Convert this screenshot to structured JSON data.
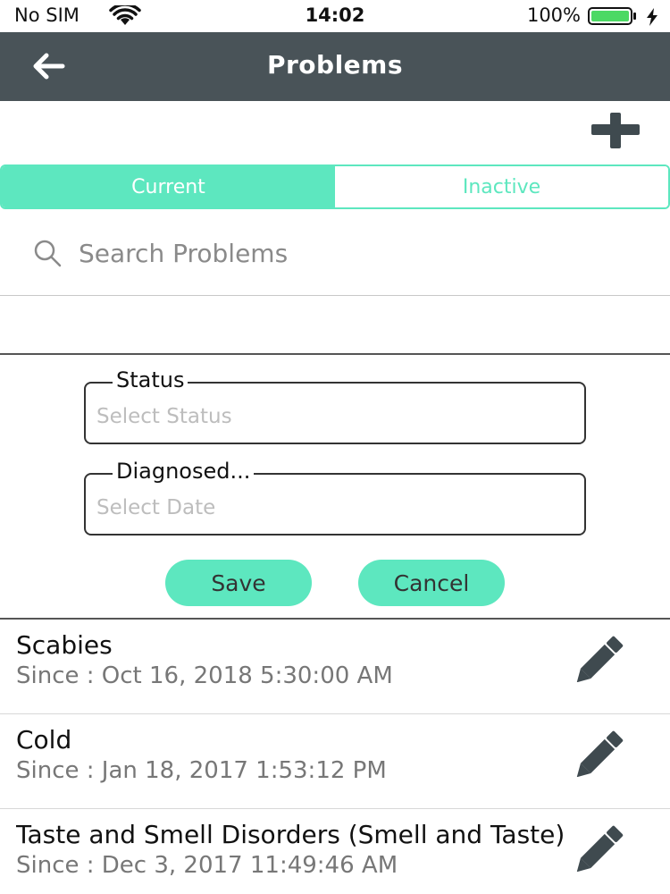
{
  "status_bar": {
    "carrier": "No SIM",
    "time": "14:02",
    "battery": "100%",
    "icons": [
      "wifi-icon",
      "battery-icon",
      "charging-bolt-icon"
    ]
  },
  "header": {
    "title": "Problems",
    "back_icon": "arrow-left-icon",
    "add_icon": "plus-icon"
  },
  "tabs": [
    {
      "label": "Current",
      "active": true
    },
    {
      "label": "Inactive",
      "active": false
    }
  ],
  "search": {
    "placeholder": "Search Problems",
    "value": "",
    "icon": "search-icon"
  },
  "form": {
    "status": {
      "label": "Status",
      "placeholder": "Select Status"
    },
    "diagnosed": {
      "label": "Diagnosed...",
      "placeholder": "Select Date"
    },
    "save_label": "Save",
    "cancel_label": "Cancel"
  },
  "problems": [
    {
      "name": "Scabies",
      "since": "Since : Oct 16, 2018 5:30:00 AM"
    },
    {
      "name": "Cold",
      "since": "Since : Jan 18, 2017 1:53:12 PM"
    },
    {
      "name": "Taste and Smell Disorders (Smell and Taste)",
      "since": "Since : Dec 3, 2017 11:49:46 AM"
    }
  ],
  "colors": {
    "accent": "#5de7bf",
    "nav_bg": "#495358",
    "icon_dark": "#3f4a4f",
    "battery_green": "#4cd964"
  }
}
